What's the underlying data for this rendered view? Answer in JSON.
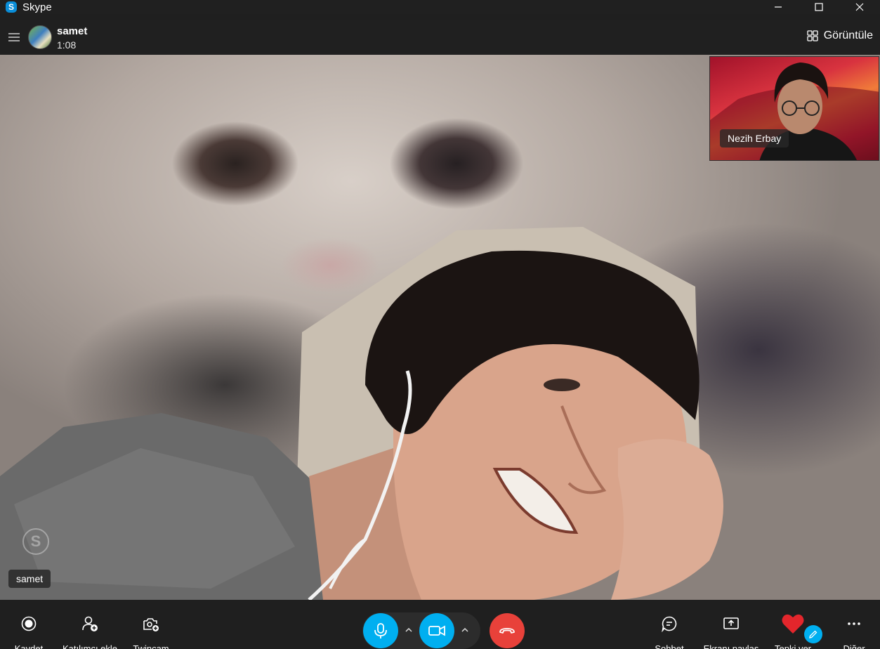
{
  "window": {
    "app_title": "Skype",
    "logo_letter": "S",
    "controls": [
      "minimize-icon",
      "maximize-icon",
      "close-icon"
    ]
  },
  "call": {
    "contact_name": "samet",
    "duration": "1:08",
    "view_button_label": "Görüntüle"
  },
  "main_video": {
    "participant_name": "samet"
  },
  "self_view": {
    "participant_name": "Nezih Erbay"
  },
  "controls": {
    "left": [
      {
        "label": "Kaydet",
        "icon": "record-icon"
      },
      {
        "label": "Katılımcı ekle",
        "icon": "add-participant-icon"
      },
      {
        "label": "Twincam",
        "icon": "twincam-icon"
      }
    ],
    "center": [
      {
        "icon": "microphone-icon",
        "color": "#00aff0"
      },
      {
        "icon": "video-camera-icon",
        "color": "#00aff0"
      },
      {
        "icon": "end-call-icon",
        "color": "#e8413a"
      }
    ],
    "right": [
      {
        "label": "Sohbet",
        "icon": "chat-icon"
      },
      {
        "label": "Ekranı paylaş",
        "icon": "share-screen-icon"
      },
      {
        "label": "Tepki ver",
        "icon": "heart-icon"
      },
      {
        "label": "Diğer",
        "icon": "more-icon"
      }
    ]
  },
  "colors": {
    "accent": "#00aff0",
    "end_call": "#e8413a",
    "reaction": "#e3262c",
    "background": "#1f1f1f"
  }
}
